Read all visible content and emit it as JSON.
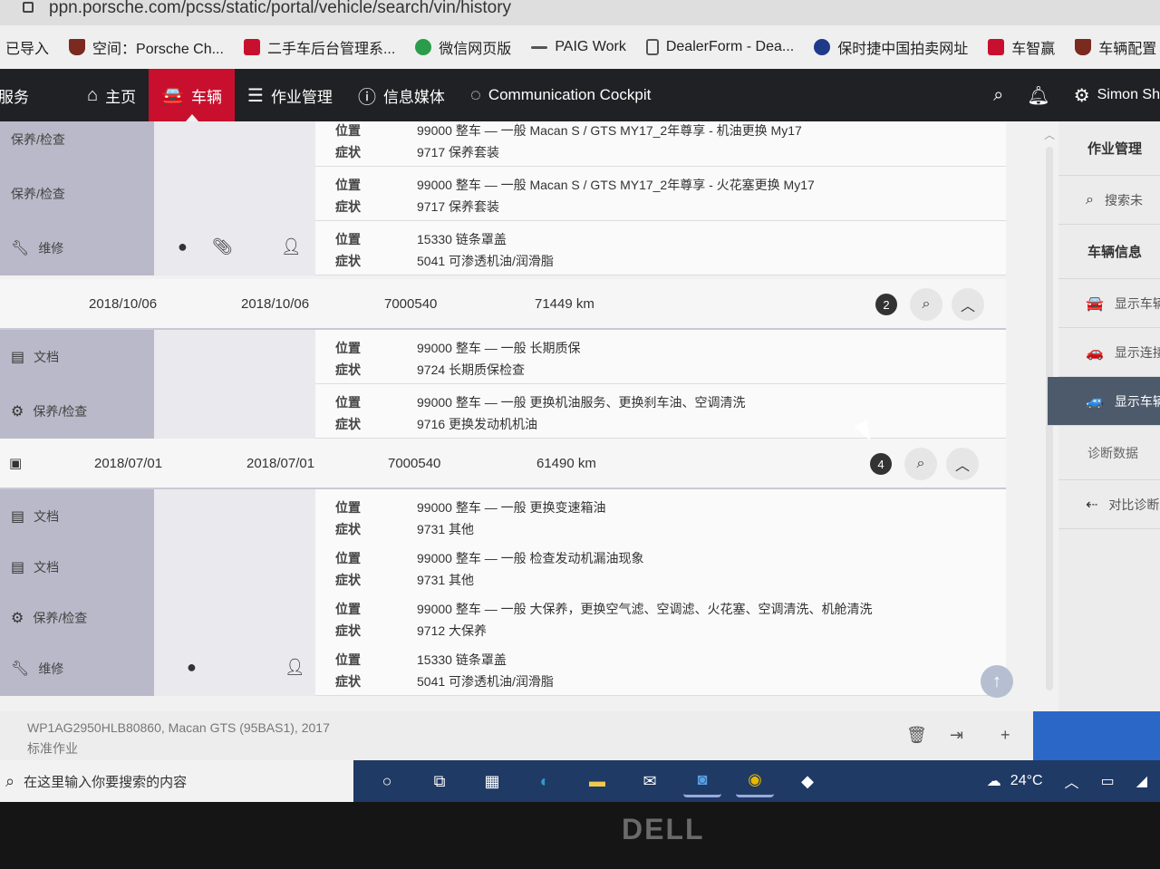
{
  "browser": {
    "url": "ppn.porsche.com/pcss/static/portal/vehicle/search/vin/history"
  },
  "bookmarks": [
    {
      "label": "已导入",
      "icon": "folder-icon",
      "color": "#666666"
    },
    {
      "label": "空间：Porsche Ch...",
      "icon": "porsche-crest-icon",
      "color": "#7a2a1e"
    },
    {
      "label": "二手车后台管理系...",
      "icon": "p-logo-icon",
      "color": "#c8102e"
    },
    {
      "label": "微信网页版",
      "icon": "wechat-icon",
      "color": "#2a9d4a"
    },
    {
      "label": "PAIG Work",
      "icon": "dash-icon",
      "color": "#555555"
    },
    {
      "label": "DealerForm - Dea...",
      "icon": "document-icon",
      "color": "#555555"
    },
    {
      "label": "保时捷中国拍卖网址",
      "icon": "vw-logo-icon",
      "color": "#1f3a8a"
    },
    {
      "label": "车智赢",
      "icon": "grid-logo-icon",
      "color": "#c8102e"
    },
    {
      "label": "车辆配置",
      "icon": "porsche-crest-icon",
      "color": "#7a2a1e"
    }
  ],
  "nav": {
    "items": [
      {
        "label": "服务",
        "icon": ""
      },
      {
        "label": "主页",
        "icon": "home-icon"
      },
      {
        "label": "车辆",
        "icon": "car-icon",
        "active": true
      },
      {
        "label": "作业管理",
        "icon": "list-icon"
      },
      {
        "label": "信息媒体",
        "icon": "info-icon"
      },
      {
        "label": "Communication Cockpit",
        "icon": "chat-icon"
      }
    ],
    "user": "Simon Sh"
  },
  "history": {
    "labels": {
      "position": "位置",
      "symptom": "症状"
    },
    "top_subrows": [
      {
        "category": "保养/检查",
        "position": "99000 整车 — 一般   Macan S / GTS MY17_2年尊享 - 机油更换 My17",
        "symptom": "9717 保养套装"
      },
      {
        "category": "保养/检查",
        "position": "99000 整车 — 一般   Macan S / GTS MY17_2年尊享 - 火花塞更换 My17",
        "symptom": "9717 保养套装"
      },
      {
        "category": "维修",
        "position": "15330 链条罩盖",
        "symptom": "5041 可渗透机油/润滑脂"
      }
    ],
    "entries": [
      {
        "date_start": "2018/10/06",
        "date_end": "2018/10/06",
        "dealer": "7000540",
        "mileage": "71449 km",
        "count": "2",
        "subrows": [
          {
            "category": "文档",
            "position": "99000 整车 — 一般   长期质保",
            "symptom": "9724 长期质保检查"
          },
          {
            "category": "保养/检查",
            "position": "99000 整车 — 一般   更换机油服务、更换刹车油、空调清洗",
            "symptom": "9716 更换发动机机油"
          }
        ]
      },
      {
        "date_start": "2018/07/01",
        "date_end": "2018/07/01",
        "dealer": "7000540",
        "mileage": "61490 km",
        "count": "4",
        "subrows": [
          {
            "category": "文档",
            "position": "99000 整车 — 一般   更换变速箱油",
            "symptom": "9731 其他"
          },
          {
            "category": "文档",
            "position": "99000 整车 — 一般   检查发动机漏油现象",
            "symptom": "9731 其他"
          },
          {
            "category": "保养/检查",
            "position": "99000 整车 — 一般   大保养，更换空气滤、空调滤、火花塞、空调清洗、机舱清洗",
            "symptom": "9712 大保养"
          },
          {
            "category": "维修",
            "position": "15330 链条罩盖",
            "symptom": "5041 可渗透机油/润滑脂"
          }
        ]
      }
    ]
  },
  "sidebar": {
    "headers": [
      "作业管理",
      "车辆信息",
      "诊断数据"
    ],
    "items": [
      {
        "label": "搜索未",
        "icon": "search-icon"
      },
      {
        "label": "显示车辆",
        "icon": "car-icon"
      },
      {
        "label": "显示连接",
        "icon": "connected-car-icon"
      },
      {
        "label": "显示车辆",
        "icon": "car-history-icon"
      },
      {
        "label": "对比诊断",
        "icon": "compare-icon"
      }
    ]
  },
  "footer": {
    "vehicle": "WP1AG2950HLB80860, Macan GTS (95BAS1), 2017",
    "job_type": "标准作业"
  },
  "taskbar": {
    "search_placeholder": "在这里输入你要搜索的内容",
    "temperature": "24°C"
  },
  "brand": {
    "laptop": "DELL"
  },
  "colors": {
    "accent": "#c8102e",
    "nav_bg": "#202124",
    "category_bg": "#b9b9c9",
    "active_sidebar": "#4d5a6c"
  }
}
